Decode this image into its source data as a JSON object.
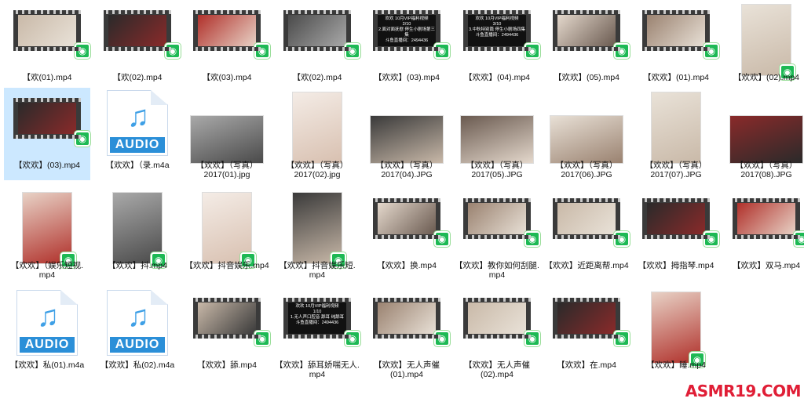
{
  "files": [
    {
      "label": "【欢(01).mp4",
      "kind": "video"
    },
    {
      "label": "【欢(02).mp4",
      "kind": "video"
    },
    {
      "label": "【欢(03).mp4",
      "kind": "video"
    },
    {
      "label": "【欢(02).mp4",
      "kind": "video"
    },
    {
      "label": "【欢欢】(03).mp4",
      "kind": "video-text",
      "overlay": "欢欢 10月VIP福利视频\n2/10\n2.面对面抚慰 停生小剧场第三集\n斗鱼直播间：2494436"
    },
    {
      "label": "【欢欢】(04).mp4",
      "kind": "video-text",
      "overlay": "欢欢 10月VIP福利视频\n3/10\n3.中秋特别篇 停生小剧场四集\n斗鱼直播间：2494436"
    },
    {
      "label": "【欢欢】(05).mp4",
      "kind": "video"
    },
    {
      "label": "【欢欢】(01).mp4",
      "kind": "video"
    },
    {
      "label": "【欢欢】(02).mp4",
      "kind": "portrait"
    },
    {
      "label": "【欢欢】(03).mp4",
      "kind": "video",
      "selected": true
    },
    {
      "label": "【欢欢】（录.m4a",
      "kind": "audio"
    },
    {
      "label": "【欢欢】（写真）\n2017(01).jpg",
      "kind": "photo-land"
    },
    {
      "label": "【欢欢】（写真）\n2017(02).jpg",
      "kind": "photo-port"
    },
    {
      "label": "【欢欢】（写真）\n2017(04).JPG",
      "kind": "photo-land"
    },
    {
      "label": "【欢欢】（写真）\n2017(05).JPG",
      "kind": "photo-land"
    },
    {
      "label": "【欢欢】（写真）\n2017(06).JPG",
      "kind": "photo-land"
    },
    {
      "label": "【欢欢】（写真）\n2017(07).JPG",
      "kind": "photo-port"
    },
    {
      "label": "【欢欢】（写真）\n2017(08).JPG",
      "kind": "photo-land"
    },
    {
      "label": "【欢欢】（娱乐短视.\nmp4",
      "kind": "portrait"
    },
    {
      "label": "【欢欢】抖.mp4",
      "kind": "portrait"
    },
    {
      "label": "【欢欢】抖音娱乐.mp4",
      "kind": "portrait"
    },
    {
      "label": "【欢欢】抖音娱乐短.\nmp4",
      "kind": "portrait"
    },
    {
      "label": "【欢欢】换.mp4",
      "kind": "video"
    },
    {
      "label": "【欢欢】教你如何刮腿.\nmp4",
      "kind": "video"
    },
    {
      "label": "【欢欢】近距离帮.mp4",
      "kind": "video"
    },
    {
      "label": "【欢欢】拇指琴.mp4",
      "kind": "video"
    },
    {
      "label": "【欢欢】双马.mp4",
      "kind": "video"
    },
    {
      "label": "【欢欢】私(01).m4a",
      "kind": "audio"
    },
    {
      "label": "【欢欢】私(02).m4a",
      "kind": "audio"
    },
    {
      "label": "【欢欢】舔.mp4",
      "kind": "video"
    },
    {
      "label": "【欢欢】舔耳娇喘无人.\nmp4",
      "kind": "video-text",
      "overlay": "欢欢 10月VIP福利视频\n1/10\n1.无人声口腔音 舔耳 纯舔耳\n斗鱼直播间：2494436"
    },
    {
      "label": "【欢欢】无人声催\n(01).mp4",
      "kind": "video"
    },
    {
      "label": "【欢欢】无人声催\n(02).mp4",
      "kind": "video"
    },
    {
      "label": "【欢欢】在.mp4",
      "kind": "video"
    },
    {
      "label": "【欢欢】睡.mp4",
      "kind": "portrait"
    }
  ],
  "audio_bar_text": "AUDIO",
  "watermark": "ASMR19.COM",
  "watermark_sub": "ASMR19.COM",
  "colors": {
    "selection": "#cce8ff",
    "badge": "#1db954",
    "audio": "#2b8fd8",
    "watermark": "#e01e36"
  }
}
